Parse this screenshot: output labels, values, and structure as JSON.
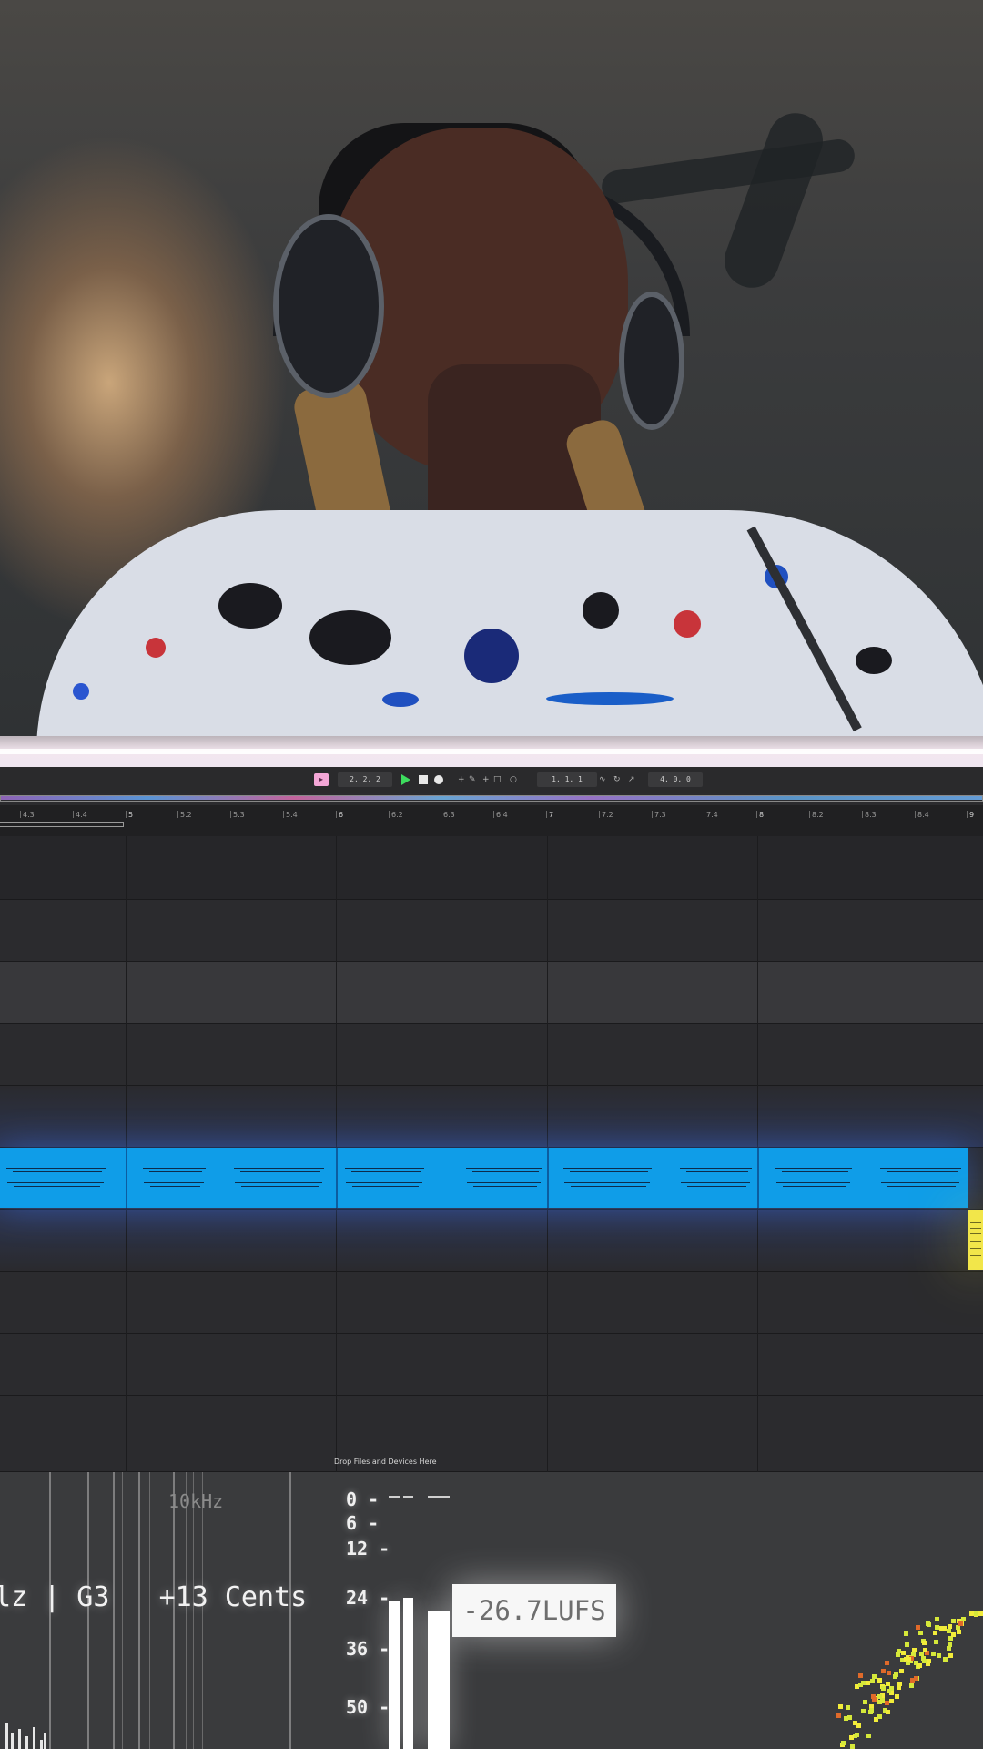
{
  "transport": {
    "tempo_badge": "▸",
    "position": "2. 2. 2",
    "loop_start": "1. 1. 1",
    "loop_length": "4. 0. 0"
  },
  "ruler": {
    "labels": [
      "4.3",
      "4.4",
      "5",
      "5.2",
      "5.3",
      "5.4",
      "6",
      "6.2",
      "6.3",
      "6.4",
      "7",
      "7.2",
      "7.3",
      "7.4",
      "8",
      "8.2",
      "8.3",
      "8.4",
      "9"
    ]
  },
  "arrangement": {
    "drop_hint": "Drop Files and Devices Here"
  },
  "analyzer": {
    "freq_label": "10kHz",
    "pitch_readout": "lz | G3   +13 Cents",
    "scale_labels": [
      "0 -",
      "6 -",
      "12 -",
      "24 -",
      "36 -",
      "50 -"
    ],
    "lufs": "-26.7LUFS"
  },
  "colors": {
    "midi_clip": "#0f9de8",
    "yellow_clip": "#f2e64a",
    "play": "#3ddc5e",
    "tempo_badge": "#f3a6d6"
  },
  "icons": [
    "play-icon",
    "stop-icon",
    "record-icon",
    "pencil-icon",
    "loop-icon",
    "metronome-icon"
  ]
}
